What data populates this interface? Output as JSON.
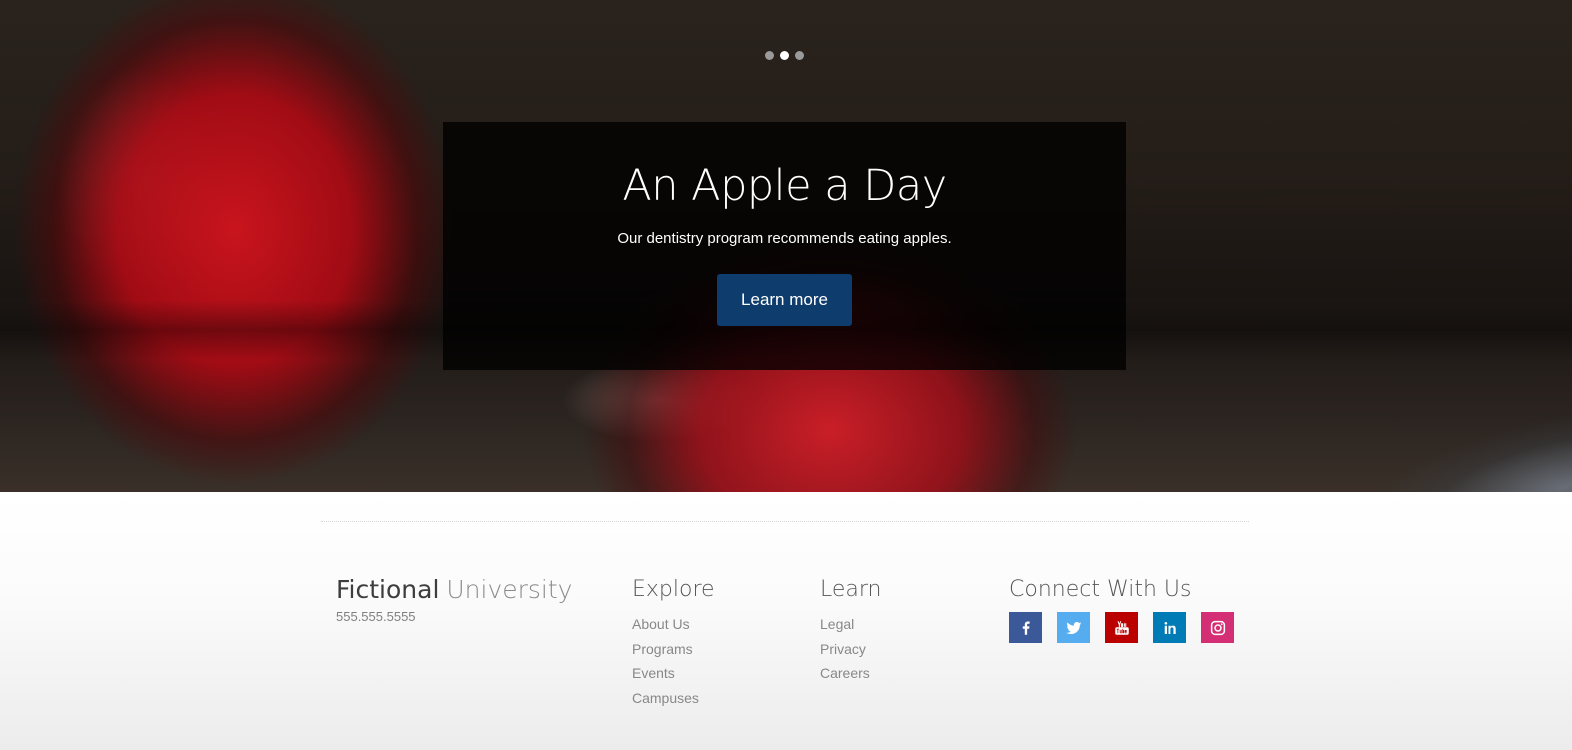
{
  "hero": {
    "title": "An Apple a Day",
    "subtitle": "Our dentistry program recommends eating apples.",
    "button_label": "Learn more",
    "slides": {
      "count": 3,
      "active_index": 1
    }
  },
  "footer": {
    "brand_primary": "Fictional",
    "brand_secondary": "University",
    "phone": "555.555.5555",
    "explore": {
      "heading": "Explore",
      "links": [
        "About Us",
        "Programs",
        "Events",
        "Campuses"
      ]
    },
    "learn": {
      "heading": "Learn",
      "links": [
        "Legal",
        "Privacy",
        "Careers"
      ]
    },
    "connect": {
      "heading": "Connect With Us",
      "social": [
        {
          "icon": "facebook-icon",
          "color": "#3b5998"
        },
        {
          "icon": "twitter-icon",
          "color": "#55acee"
        },
        {
          "icon": "youtube-icon",
          "color": "#bb0000"
        },
        {
          "icon": "linkedin-icon",
          "color": "#007bb5"
        },
        {
          "icon": "instagram-icon",
          "color": "#d42f74"
        }
      ]
    }
  }
}
